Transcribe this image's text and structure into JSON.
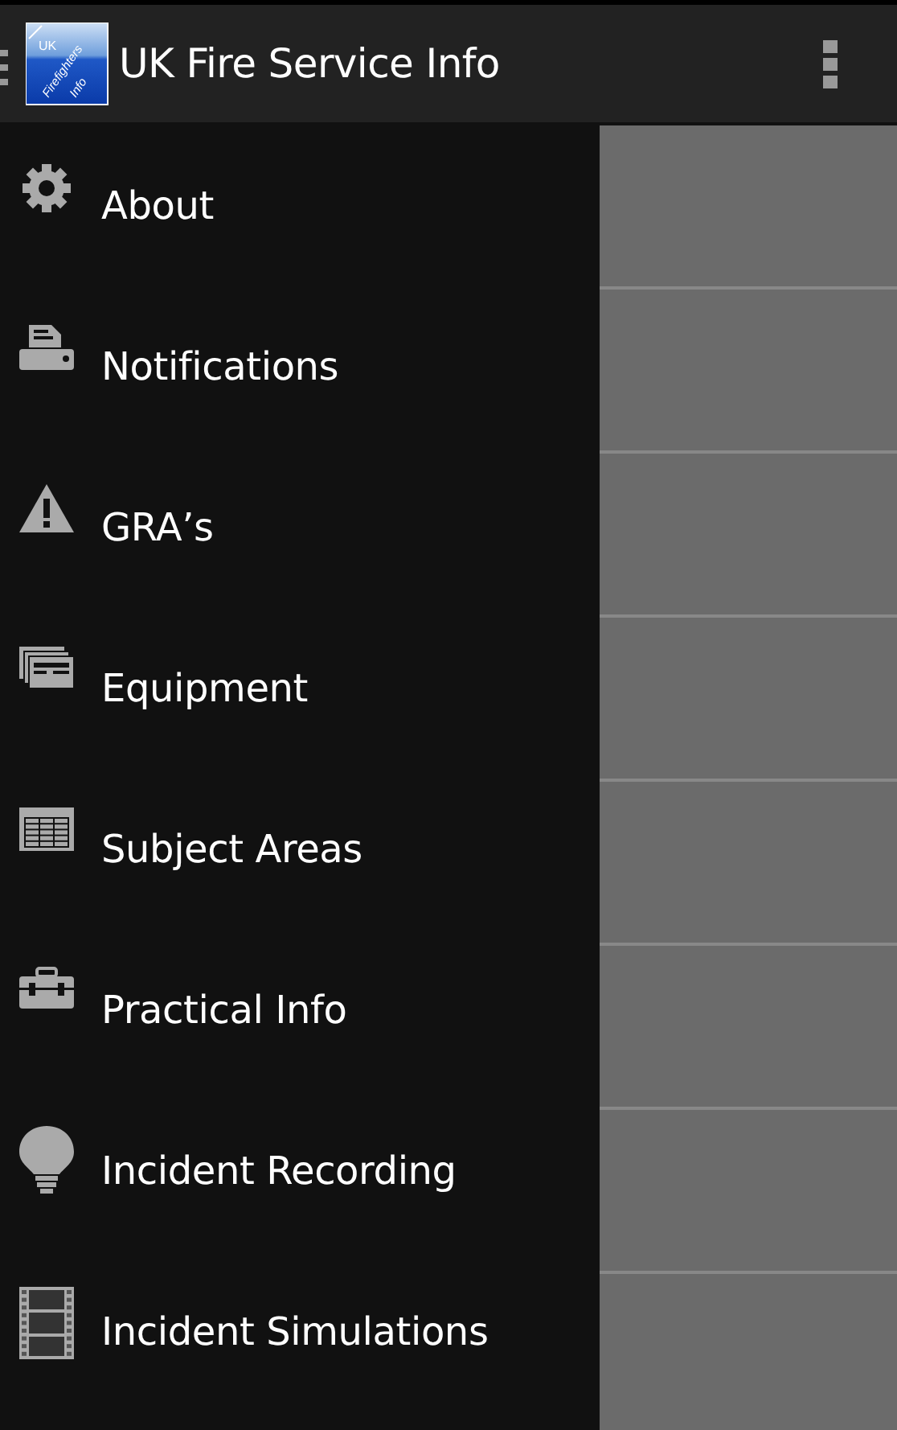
{
  "action_bar": {
    "title": "UK Fire Service Info",
    "logo_text": [
      "UK",
      "Firefighters",
      "Info"
    ]
  },
  "drawer": {
    "items": [
      {
        "label": "About"
      },
      {
        "label": "Notifications"
      },
      {
        "label": "GRA’s"
      },
      {
        "label": "Equipment"
      },
      {
        "label": "Subject Areas"
      },
      {
        "label": "Practical Info"
      },
      {
        "label": "Incident Recording"
      },
      {
        "label": "Incident Simulations"
      }
    ]
  }
}
